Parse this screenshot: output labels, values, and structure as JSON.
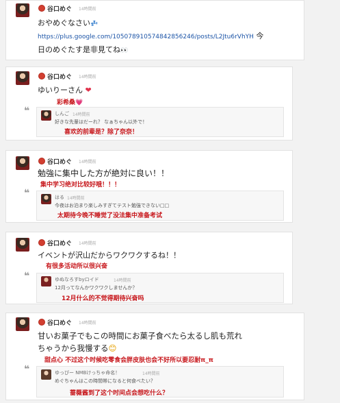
{
  "posts": [
    {
      "author": "谷口めぐ",
      "time": "14時間前",
      "line1": "おやめぐなさい",
      "line1_emoji": "💤",
      "line2_link": "https://plus.google.com/105078910574842856246/posts/L2Jtu6rVhYH",
      "line2_tail": " 今",
      "line3": "日のめぐたす是非見てね",
      "line3_emoji": "👀"
    },
    {
      "author": "谷口めぐ",
      "time": "14時間前",
      "text": "ゆいりーさん",
      "emoji": "❤",
      "translation": "彩希桑",
      "translation_emoji": "💗",
      "reply": {
        "name": "しんご",
        "time": "14時間前",
        "text": "好きな先輩はだーれ？ なぁちゃん以外で！",
        "translation": "喜欢的前辈是？除了奈奈！"
      }
    },
    {
      "author": "谷口めぐ",
      "time": "14時間前",
      "text": "勉強に集中した方が絶対に良い！！",
      "translation": "集中学习绝对比较好哦！！！",
      "reply": {
        "name": "はる",
        "time": "14時間前",
        "text": "今夜はお泊まり楽しみすぎてテスト勉強できない□□",
        "translation": "太期待今晚不睡觉了没法集中准备考试"
      }
    },
    {
      "author": "谷口めぐ",
      "time": "14時間前",
      "text": "イベントが沢山だからワクワクするね！！",
      "translation": "有很多活动所以很兴奋",
      "reply": {
        "name": "ゆぬなろすbyロイド",
        "time": "14時間前",
        "text": "12月ってなんかワクワクしませんか？",
        "translation": "12月什么的不觉得期待兴奋吗"
      }
    },
    {
      "author": "谷口めぐ",
      "time": "14時間前",
      "line1": "甘いお菓子でもこの時間にお菓子食べたら太るし肌も荒れ",
      "line2": "ちゃうから我慢する",
      "line2_emoji": "😊",
      "translation": "甜点心 不过这个时候吃零食会胖皮肤也会不好所以要忍耐π_π",
      "reply": {
        "name": "ゆっぴー NMBけっちゃ命名！",
        "time": "14時間前",
        "text": "めぐちゃんはこの時間帯になると何食べたい？",
        "translation": "蔷薇酱到了这个时间点会想吃什么？"
      }
    }
  ]
}
